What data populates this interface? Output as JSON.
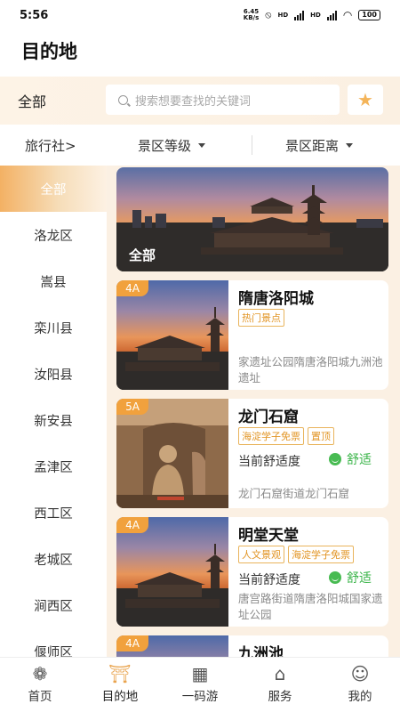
{
  "status_bar": {
    "time": "5:56",
    "net_speed_top": "6.45",
    "net_speed_bottom": "KB/s",
    "signal1": "HD",
    "signal2": "HD",
    "battery": "100"
  },
  "header": {
    "title": "目的地"
  },
  "search": {
    "all_label": "全部",
    "placeholder": "搜索想要查找的关键词"
  },
  "filters": {
    "agency": "旅行社>",
    "level": "景区等级",
    "distance": "景区距离"
  },
  "sidebar": {
    "items": [
      {
        "label": "全部",
        "active": true
      },
      {
        "label": "洛龙区"
      },
      {
        "label": "嵩县"
      },
      {
        "label": "栾川县"
      },
      {
        "label": "汝阳县"
      },
      {
        "label": "新安县"
      },
      {
        "label": "孟津区"
      },
      {
        "label": "西工区"
      },
      {
        "label": "老城区"
      },
      {
        "label": "涧西区"
      },
      {
        "label": "偃师区"
      }
    ]
  },
  "hero": {
    "label": "全部"
  },
  "cards": [
    {
      "grade": "4A",
      "name": "隋唐洛阳城",
      "tags": [
        "热门景点"
      ],
      "comfort_label": "",
      "comfort_status": "",
      "address": "家遗址公园隋唐洛阳城九洲池遗址"
    },
    {
      "grade": "5A",
      "name": "龙门石窟",
      "tags": [
        "海淀学子免票",
        "置顶"
      ],
      "comfort_label": "当前舒适度",
      "comfort_status": "舒适",
      "address": "龙门石窟街道龙门石窟"
    },
    {
      "grade": "4A",
      "name": "明堂天堂",
      "tags": [
        "人文景观",
        "海淀学子免票"
      ],
      "comfort_label": "当前舒适度",
      "comfort_status": "舒适",
      "address": "唐宫路街道隋唐洛阳城国家遗址公园"
    },
    {
      "grade": "4A",
      "name": "九洲池"
    }
  ],
  "tabs": [
    {
      "label": "首页",
      "icon": "home-icon"
    },
    {
      "label": "目的地",
      "icon": "destination-icon",
      "active": true
    },
    {
      "label": "一码游",
      "icon": "qr-tour-icon"
    },
    {
      "label": "服务",
      "icon": "service-icon"
    },
    {
      "label": "我的",
      "icon": "profile-icon"
    }
  ],
  "colors": {
    "accent": "#f1a13d",
    "comfort_green": "#3bb54a",
    "tag_border": "#e9b45c",
    "panel_bg": "#fbf0e3"
  }
}
